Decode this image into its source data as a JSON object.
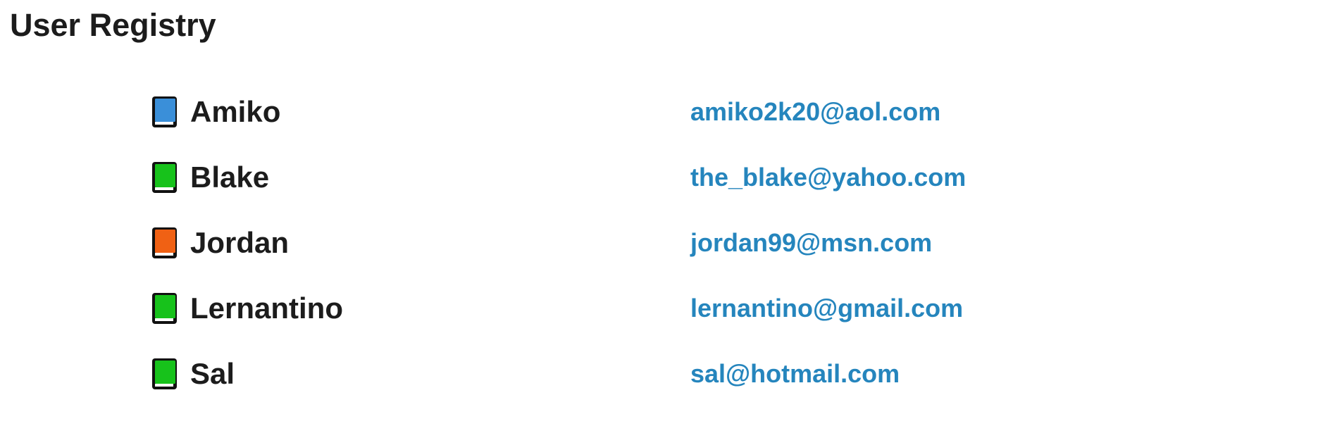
{
  "page": {
    "title": "User Registry"
  },
  "users": [
    {
      "name": "Amiko",
      "email": "amiko2k20@aol.com",
      "icon": "blue-book-icon",
      "icon_color": "#3a8fd9"
    },
    {
      "name": "Blake",
      "email": "the_blake@yahoo.com",
      "icon": "green-book-icon",
      "icon_color": "#17c21b"
    },
    {
      "name": "Jordan",
      "email": "jordan99@msn.com",
      "icon": "orange-book-icon",
      "icon_color": "#f06114"
    },
    {
      "name": "Lernantino",
      "email": "lernantino@gmail.com",
      "icon": "green-book-icon",
      "icon_color": "#17c21b"
    },
    {
      "name": "Sal",
      "email": "sal@hotmail.com",
      "icon": "green-book-icon",
      "icon_color": "#17c21b"
    }
  ],
  "colors": {
    "text": "#1c1c1c",
    "link": "#2585bd",
    "background": "#ffffff"
  }
}
